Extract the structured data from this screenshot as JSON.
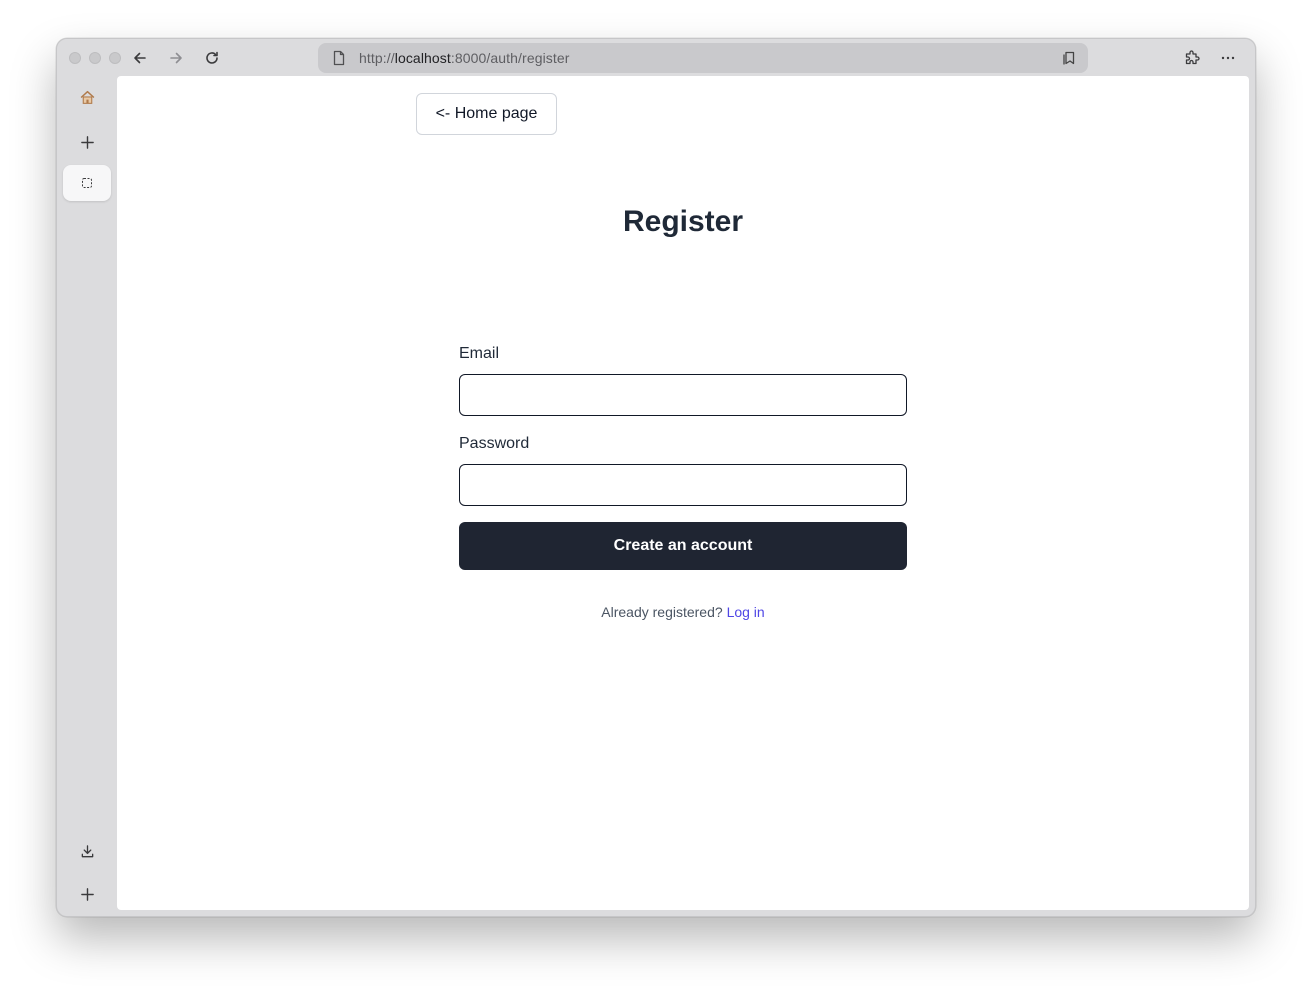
{
  "browser": {
    "url_scheme": "http://",
    "url_host": "localhost",
    "url_rest": ":8000/auth/register"
  },
  "page": {
    "home_button": "<- Home page",
    "title": "Register",
    "email_label": "Email",
    "email_value": "",
    "password_label": "Password",
    "password_value": "",
    "submit_label": "Create an account",
    "already_text": "Already registered?",
    "login_link": "Log in"
  },
  "colors": {
    "primary_button": "#1f2532",
    "link": "#4f46e5",
    "heading": "#1f2937"
  },
  "icons": {
    "sidebar": [
      "home-icon",
      "plus-icon",
      "tab-select-icon",
      "download-icon",
      "plus-icon"
    ],
    "toolbar": [
      "back-arrow-icon",
      "forward-arrow-icon",
      "reload-icon",
      "page-icon",
      "bookmark-icon",
      "extensions-icon",
      "more-icon"
    ]
  }
}
